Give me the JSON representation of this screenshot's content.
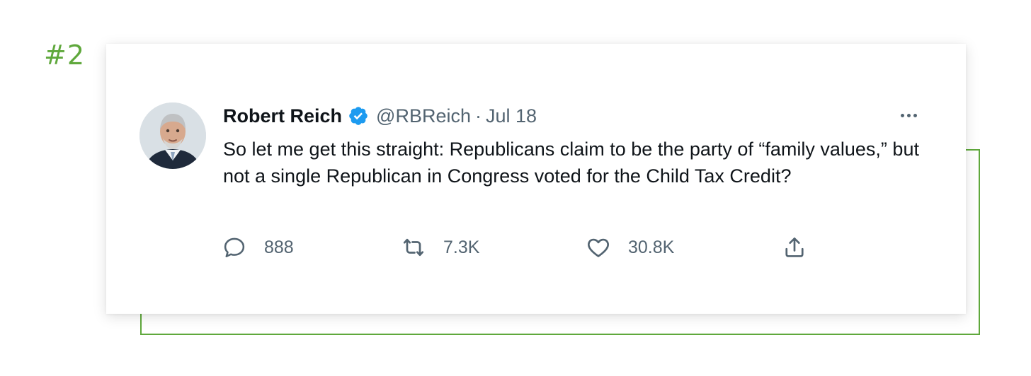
{
  "rank_label": "#2",
  "tweet": {
    "author_name": "Robert Reich",
    "verified": true,
    "handle": "@RBReich",
    "separator": "·",
    "date": "Jul 18",
    "text": "So let me get this straight: Republicans claim to be the party of “family values,” but not a single Republican in Congress voted for the Child Tax Credit?",
    "actions": {
      "reply": {
        "icon": "reply-icon",
        "count": "888"
      },
      "retweet": {
        "icon": "retweet-icon",
        "count": "7.3K"
      },
      "like": {
        "icon": "heart-icon",
        "count": "30.8K"
      },
      "share": {
        "icon": "share-icon"
      }
    },
    "more_icon": "more-options-icon"
  },
  "colors": {
    "accent": "#5fa83c",
    "verified": "#1d9bf0",
    "text": "#0f1419",
    "muted": "#536471"
  }
}
